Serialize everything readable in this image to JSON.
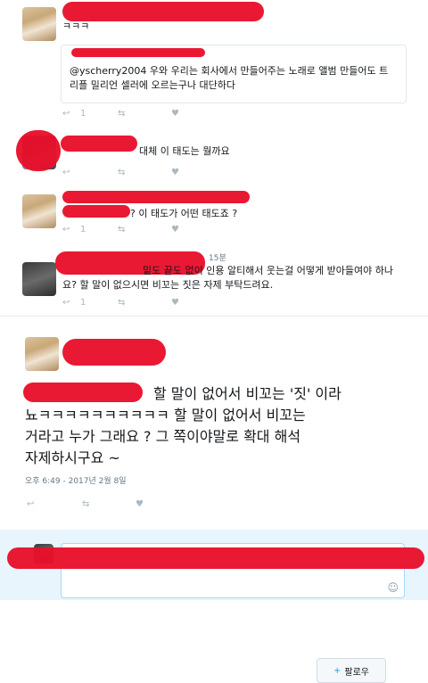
{
  "tweet1": {
    "text": "ㅋㅋㅋ",
    "quote_text_line1": "@yscherry2004  우와 우리는 회사에서 만들어주는 노래로 앨범 만들어도 트",
    "quote_text_line2": "리플 밀리언 셀러에 오르는구나 대단하다",
    "like_count": "1",
    "retweet_count": "",
    "reply_count": "1"
  },
  "tweet2": {
    "text": "대체 이 태도는 뭘까요"
  },
  "tweet3": {
    "text": "? 이 태도가 어떤 태도죠 ?",
    "time": ""
  },
  "tweet4": {
    "time": "15분",
    "text_line1": "밑도 끝도 없이 인용 알티해서 웃는걸 어떻게 받아들여야 하나",
    "text_line2": "요? 할 말이 없으시면 비꼬는 짓은 자제 부탁드려요."
  },
  "main": {
    "follow_label": "팔로우",
    "line1": "할 말이 없어서 비꼬는 '짓' 이라",
    "line2": "뇨ㅋㅋㅋㅋㅋㅋㅋㅋㅋㅋ 할 말이 없어서 비꼬는",
    "line3": "거라고 누가 그래요 ? 그 쪽이야말로 확대 해석",
    "line4": "자제하시구요 ~",
    "timestamp": "오후 6:49 - 2017년 2월 8일"
  },
  "actions": {
    "reply_count_1": "1",
    "reply_count_3": "1",
    "reply_count_4": "1"
  },
  "colors": {
    "redaction": "#e8102b",
    "border": "#e6ecf0",
    "action_grey": "#aab8c2"
  }
}
